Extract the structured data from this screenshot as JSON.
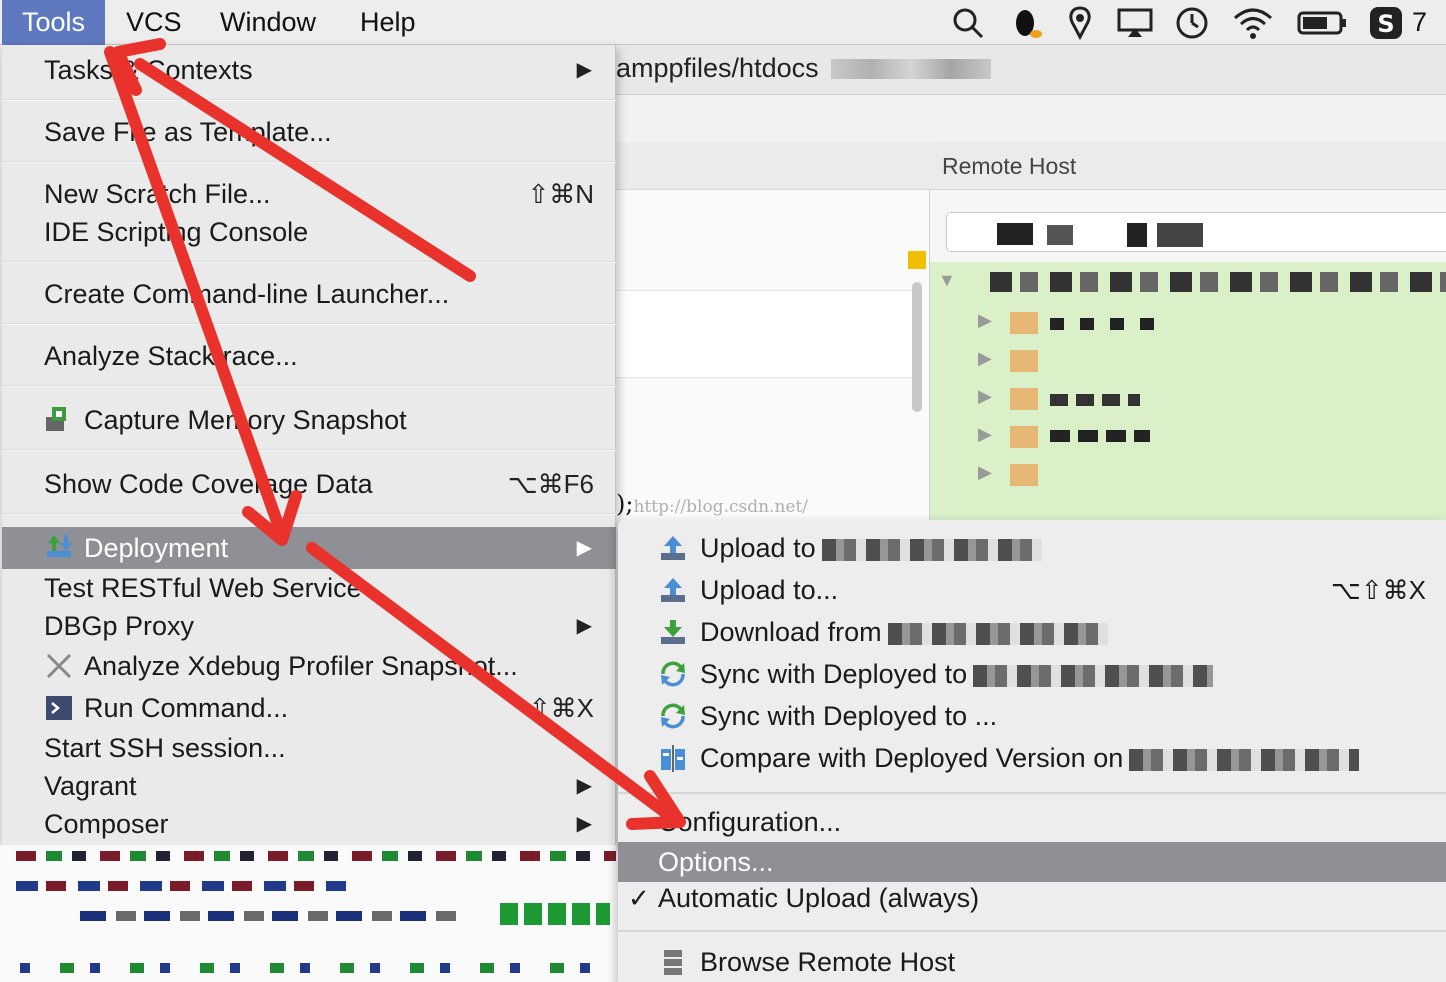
{
  "menubar": {
    "items": [
      "Tools",
      "VCS",
      "Window",
      "Help"
    ],
    "status_icons": [
      "search-icon",
      "qq-penguin-icon",
      "location-icon",
      "display-icon",
      "time-machine-icon",
      "wifi-icon",
      "battery-icon",
      "s-app-icon"
    ],
    "clock_fragment": "7"
  },
  "ide": {
    "path_fragment": "amppfiles/htdocs",
    "remote_host_title": "Remote Host",
    "watermark": "http://blog.csdn.net/",
    "editor_fragment": ");"
  },
  "tools_menu": {
    "tasks_contexts": "Tasks & Contexts",
    "save_template": "Save File as Template...",
    "new_scratch": "New Scratch File...",
    "new_scratch_shortcut": "⇧⌘N",
    "ide_scripting": "IDE Scripting Console",
    "create_launcher": "Create Command-line Launcher...",
    "analyze_stack": "Analyze Stacktrace...",
    "capture_memory": "Capture Memory Snapshot",
    "show_coverage": "Show Code Coverage Data",
    "show_coverage_shortcut": "⌥⌘F6",
    "deployment": "Deployment",
    "test_restful": "Test RESTful Web Service",
    "dbgp_proxy": "DBGp Proxy",
    "analyze_xdebug": "Analyze Xdebug Profiler Snapshot...",
    "run_command": "Run Command...",
    "run_command_shortcut": "⇧⌘X",
    "start_ssh": "Start SSH session...",
    "vagrant": "Vagrant",
    "composer": "Composer"
  },
  "deployment_menu": {
    "upload_to_default": "Upload to",
    "upload_to": "Upload to...",
    "upload_to_shortcut": "⌥⇧⌘X",
    "download_from": "Download from",
    "sync_with_default": "Sync with Deployed to",
    "sync_with": "Sync with Deployed to ...",
    "compare_with": "Compare with Deployed Version on",
    "configuration": "Configuration...",
    "options": "Options...",
    "automatic_upload": "Automatic Upload (always)",
    "automatic_upload_check": "✓",
    "browse_remote": "Browse Remote Host"
  },
  "colors": {
    "menu_highlight": "#8f8f96",
    "active_menubar": "#5e79c0",
    "annotation_arrow": "#e8322b",
    "remote_tree_bg": "#d9f0c8"
  }
}
